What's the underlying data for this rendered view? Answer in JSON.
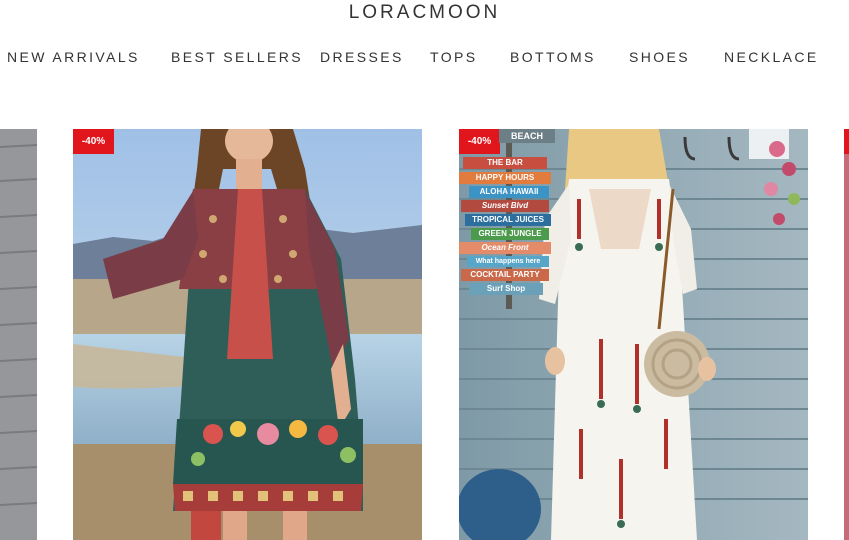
{
  "header": {
    "brand": "LORACMOON"
  },
  "nav": {
    "items": [
      {
        "label": "NEW ARRIVALS"
      },
      {
        "label": "BEST SELLERS"
      },
      {
        "label": "DRESSES"
      },
      {
        "label": "TOPS"
      },
      {
        "label": "BOTTOMS"
      },
      {
        "label": "SHOES"
      },
      {
        "label": "NECKLACE"
      }
    ]
  },
  "products": [
    {
      "badge": "-40%"
    },
    {
      "badge": "-40%"
    }
  ],
  "signs": [
    "BEACH",
    "THE BAR",
    "HAPPY HOURS",
    "ALOHA HAWAII",
    "Sunset Blvd",
    "TROPICAL JUICES",
    "GREEN JUNGLE",
    "Ocean Front",
    "What happens here",
    "COCKTAIL PARTY",
    "Surf Shop"
  ]
}
